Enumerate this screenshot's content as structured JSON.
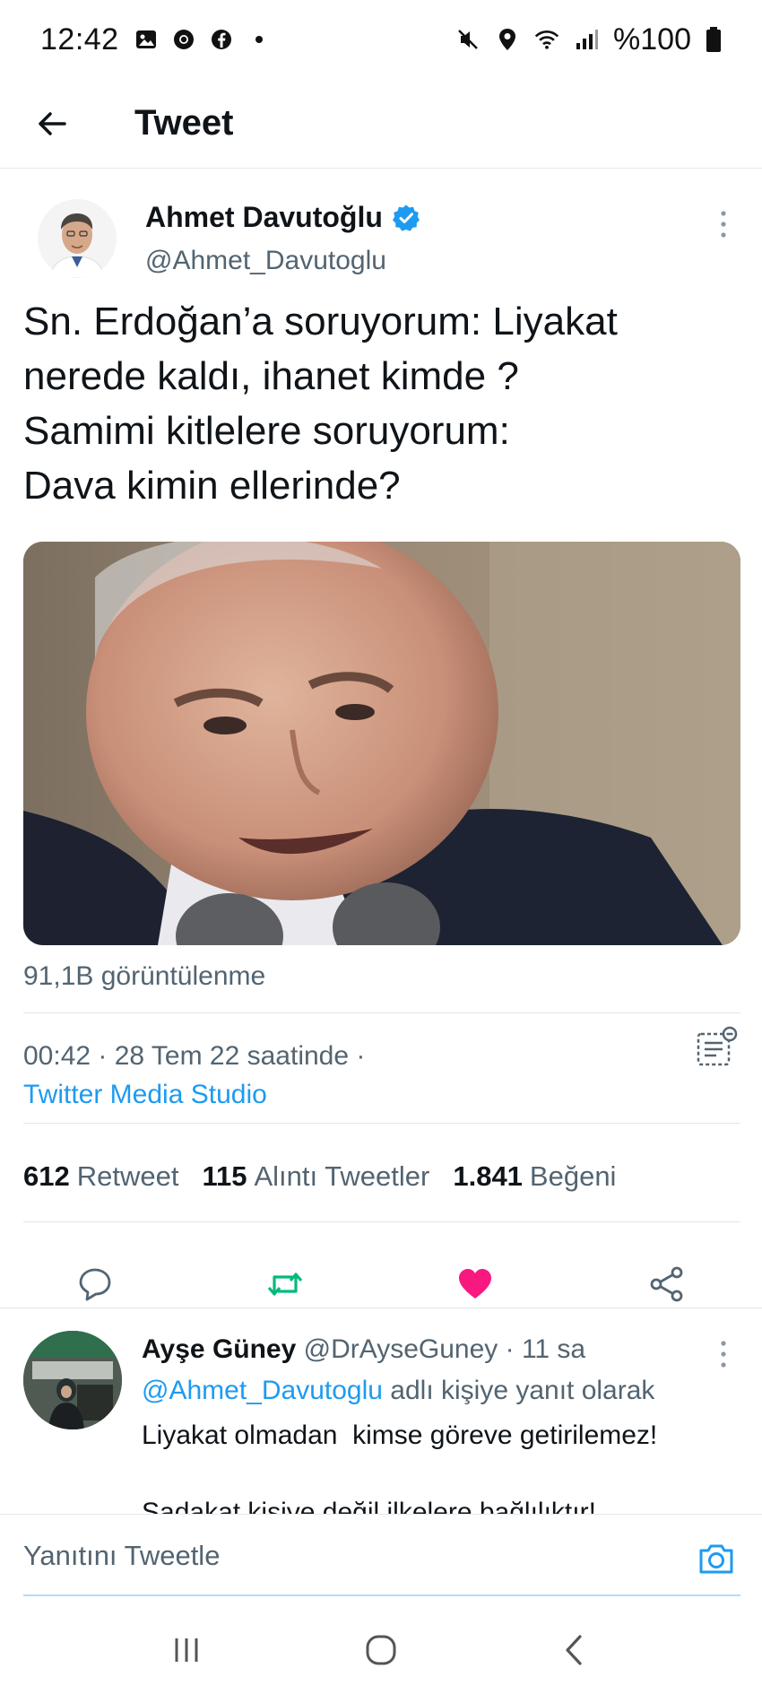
{
  "status_bar": {
    "time": "12:42",
    "battery": "%100",
    "left_icons": [
      "gallery-icon",
      "chrome-icon",
      "facebook-icon",
      "dot-icon"
    ],
    "right_icons": [
      "mute-icon",
      "location-icon",
      "wifi-icon",
      "signal-icon",
      "battery-icon"
    ]
  },
  "app_bar": {
    "title": "Tweet"
  },
  "tweet": {
    "author_name": "Ahmet Davutoğlu",
    "handle": "@Ahmet_Davutoglu",
    "text_lines": [
      "Sn. Erdoğan’a soruyorum: Liyakat",
      "nerede kaldı, ihanet kimde ?",
      "Samimi kitlelere soruyorum:",
      "Dava kimin ellerinde?"
    ],
    "views": "91,1B görüntülenme",
    "timestamp": "00:42 · 28 Tem 22 saatinde ·",
    "source": "Twitter Media Studio",
    "stats": {
      "retweets_count": "612",
      "retweets_label": "Retweet",
      "quotes_count": "115",
      "quotes_label": "Alıntı Tweetler",
      "likes_count": "1.841",
      "likes_label": "Beğeni"
    }
  },
  "reply": {
    "name": "Ayşe Güney",
    "handle_time": "@DrAyseGuney · 11 sa",
    "reply_to_mention": "@Ahmet_Davutoglu",
    "reply_to_suffix": "adlı kişiye yanıt olarak",
    "line1": "Liyakat olmadan  kimse göreve getirilemez!",
    "line2": "Sadakat kişiye değil ilkelere bağlılıktır!"
  },
  "compose": {
    "placeholder": "Yanıtını Tweetle"
  },
  "colors": {
    "accent": "#1d9bf0",
    "retweet_active": "#00ba7c",
    "like_active": "#f91880",
    "muted_text": "#536471"
  }
}
